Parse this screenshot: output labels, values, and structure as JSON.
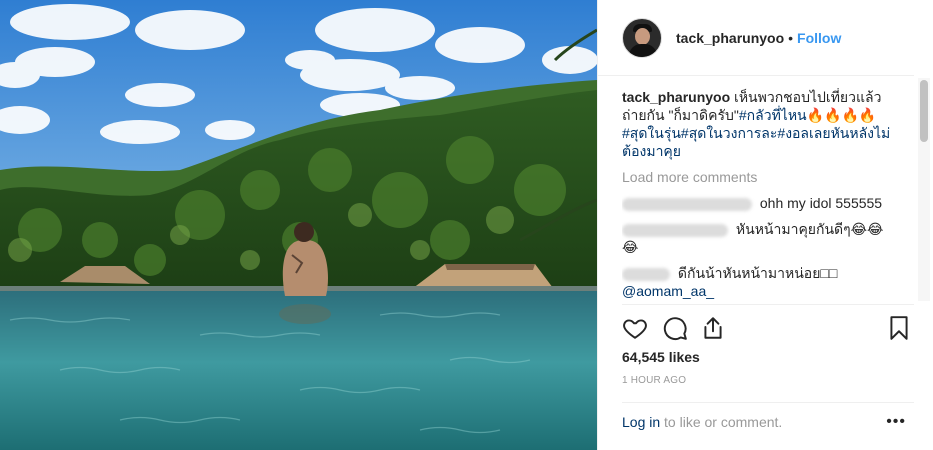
{
  "post": {
    "username": "tack_pharunyoo",
    "separator": "•",
    "follow_label": "Follow",
    "caption": {
      "user": "tack_pharunyoo",
      "text": "เห็นพวกชอบไปเที่ยวแล้วถ่ายกัน \"ก็มาดิครับ\"",
      "tags": "#กลัวที่ไหน🔥🔥🔥🔥#สุดในรุ่น#สุดในวงการละ#งอลเลยหันหลังไม่ต้องมาคุย"
    },
    "load_more_label": "Load more comments",
    "comments": [
      {
        "text": "ohh my idol 555555"
      },
      {
        "text": "หันหน้ามาคุยกันดีๆ😂😂😂"
      },
      {
        "text": "ดีกันน้าหันหน้ามาหน่อย□□",
        "mention": "@aomam_aa_"
      }
    ],
    "likes": "64,545 likes",
    "time": "1 HOUR AGO",
    "login": {
      "link": "Log in",
      "rest": " to like or comment."
    },
    "more_label": "•••"
  },
  "icons": [
    "heart-icon",
    "comment-icon",
    "share-icon",
    "bookmark-icon"
  ],
  "colors": {
    "follow": "#3897f0",
    "hashtag": "#003569",
    "muted": "#999999"
  }
}
